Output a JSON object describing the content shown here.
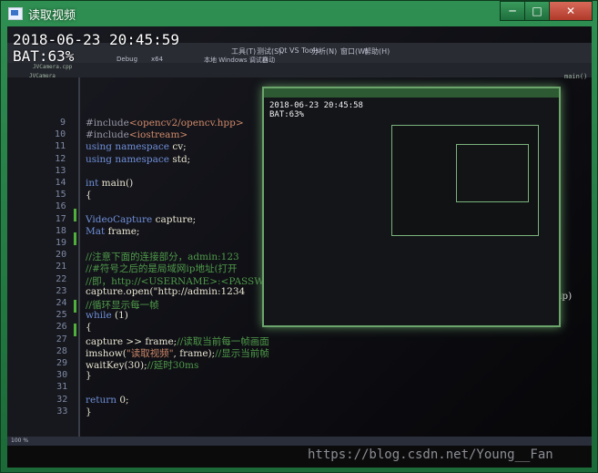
{
  "window": {
    "title": "读取视频",
    "buttons": {
      "minimize": "─",
      "maximize": "□",
      "close": "✕"
    }
  },
  "overlay": {
    "timestamp": "2018-06-23 20:45:59",
    "battery": "BAT:63%"
  },
  "inner_overlay": {
    "timestamp": "2018-06-23 20:45:58",
    "battery": "BAT:63%"
  },
  "ide": {
    "menu": [
      "工具(T)",
      "测试(S)",
      "Qt VS Tools",
      "分析(N)",
      "窗口(W)",
      "帮助(H)"
    ],
    "toolbar": [
      "Debug",
      "x64",
      "本地 Windows 调试器",
      "自动"
    ],
    "file_tab": "JVCamera.cpp",
    "scope": "JVCamera",
    "function_scope": "main()",
    "status": "100 %",
    "lines": [
      {
        "n": "9",
        "parts": [
          {
            "c": "inc",
            "t": "#include"
          },
          {
            "c": "str",
            "t": "<opencv2/opencv.hpp>"
          }
        ]
      },
      {
        "n": "10",
        "parts": [
          {
            "c": "inc",
            "t": "#include"
          },
          {
            "c": "str",
            "t": "<iostream>"
          }
        ]
      },
      {
        "n": "11",
        "parts": [
          {
            "c": "kw",
            "t": "using namespace"
          },
          {
            "c": "fn",
            "t": " cv;"
          }
        ]
      },
      {
        "n": "12",
        "parts": [
          {
            "c": "kw",
            "t": "using namespace"
          },
          {
            "c": "fn",
            "t": " std;"
          }
        ]
      },
      {
        "n": "13",
        "parts": []
      },
      {
        "n": "14",
        "parts": [
          {
            "c": "kw",
            "t": "int"
          },
          {
            "c": "fn",
            "t": " main()"
          }
        ]
      },
      {
        "n": "15",
        "parts": [
          {
            "c": "fn",
            "t": "{"
          }
        ]
      },
      {
        "n": "16",
        "parts": []
      },
      {
        "n": "17",
        "parts": [
          {
            "c": "kw",
            "t": "    VideoCapture"
          },
          {
            "c": "fn",
            "t": " capture;"
          }
        ]
      },
      {
        "n": "18",
        "parts": [
          {
            "c": "kw",
            "t": "    Mat"
          },
          {
            "c": "fn",
            "t": " frame;"
          }
        ]
      },
      {
        "n": "19",
        "parts": []
      },
      {
        "n": "20",
        "parts": [
          {
            "c": "cm",
            "t": "    //注意下面的连接部分，admin:123"
          }
        ]
      },
      {
        "n": "21",
        "parts": [
          {
            "c": "cm",
            "t": "    //#符号之后的是局域网ip地址(打开"
          }
        ]
      },
      {
        "n": "22",
        "parts": [
          {
            "c": "cm",
            "t": "    //即，http://<USERNAME>:<PASSWO"
          }
        ]
      },
      {
        "n": "23",
        "parts": [
          {
            "c": "fn",
            "t": "    capture.open(\"http://admin:1234"
          }
        ]
      },
      {
        "n": "24",
        "parts": [
          {
            "c": "cm",
            "t": "    //循环显示每一帧"
          }
        ]
      },
      {
        "n": "25",
        "parts": [
          {
            "c": "kw",
            "t": "    while"
          },
          {
            "c": "fn",
            "t": " (1)"
          }
        ]
      },
      {
        "n": "26",
        "parts": [
          {
            "c": "fn",
            "t": "    {"
          }
        ]
      },
      {
        "n": "27",
        "parts": [
          {
            "c": "fn",
            "t": "        capture >> frame;"
          },
          {
            "c": "cm",
            "t": "//读取当前每一帧画面"
          }
        ]
      },
      {
        "n": "28",
        "parts": [
          {
            "c": "fn",
            "t": "        imshow("
          },
          {
            "c": "str",
            "t": "\"读取视频\""
          },
          {
            "c": "fn",
            "t": ", frame);"
          },
          {
            "c": "cm",
            "t": "//显示当前帧"
          }
        ]
      },
      {
        "n": "29",
        "parts": [
          {
            "c": "fn",
            "t": "        waitKey(30);"
          },
          {
            "c": "cm",
            "t": "//延时30ms"
          }
        ]
      },
      {
        "n": "30",
        "parts": [
          {
            "c": "fn",
            "t": "    }"
          }
        ]
      },
      {
        "n": "31",
        "parts": []
      },
      {
        "n": "32",
        "parts": [
          {
            "c": "kw",
            "t": "    return"
          },
          {
            "c": "fn",
            "t": " 0;"
          }
        ]
      },
      {
        "n": "33",
        "parts": [
          {
            "c": "fn",
            "t": "}"
          }
        ]
      }
    ],
    "right_fragment": "ip)"
  },
  "watermark": "https://blog.csdn.net/Young__Fan"
}
